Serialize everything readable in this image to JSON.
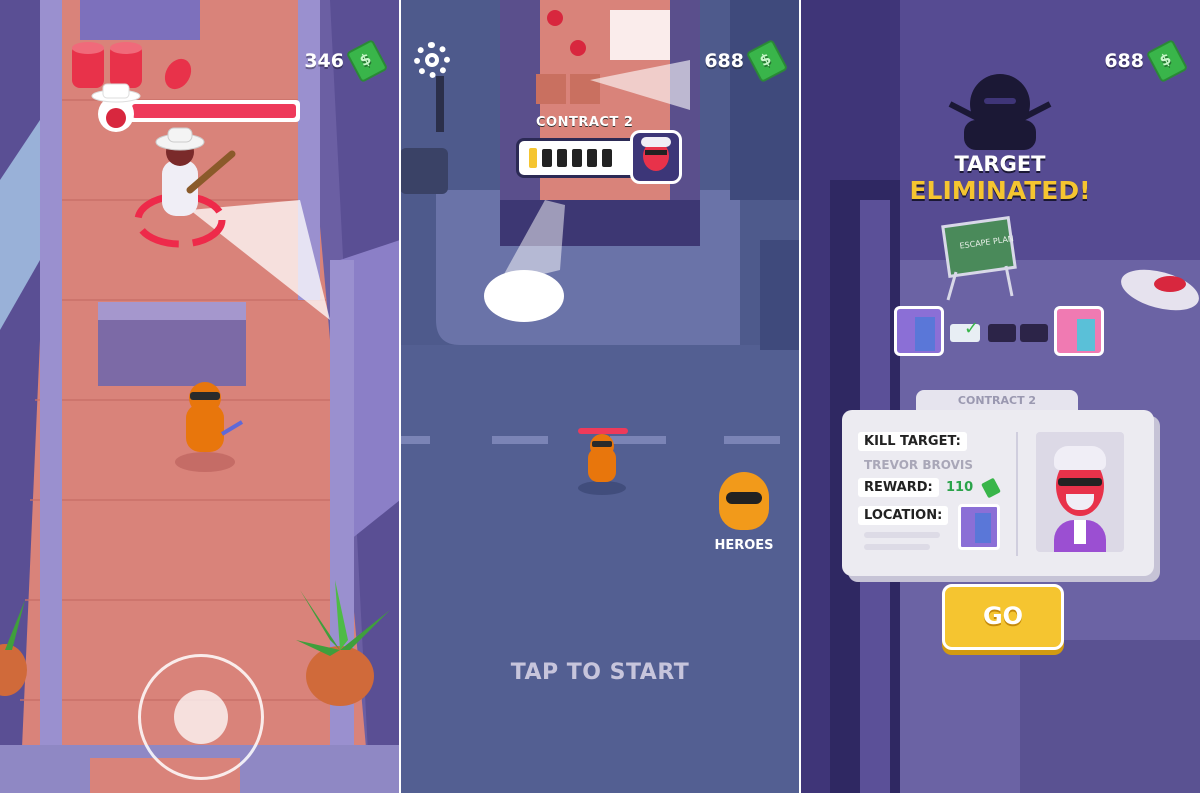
{
  "screen1": {
    "coins": "346",
    "joystick": "joystick"
  },
  "screen2": {
    "coins": "688",
    "contract_label": "CONTRACT 2",
    "heroes_label": "HEROES",
    "tap_to_start": "TAP TO START"
  },
  "screen3": {
    "coins": "688",
    "target_title": "TARGET",
    "eliminated_title": "ELIMINATED!",
    "whiteboard_text": "ESCAPE PLAN",
    "contract_tab": "CONTRACT 2",
    "kill_target_label": "KILL TARGET:",
    "target_name": "TREVOR BROVIS",
    "reward_label": "REWARD:",
    "reward_value": "110",
    "location_label": "LOCATION:",
    "go_button": "GO"
  },
  "colors": {
    "accent_yellow": "#f5c530",
    "health_red": "#ee3a5a",
    "cash_green": "#39b54a",
    "hero_orange": "#e8760c"
  }
}
